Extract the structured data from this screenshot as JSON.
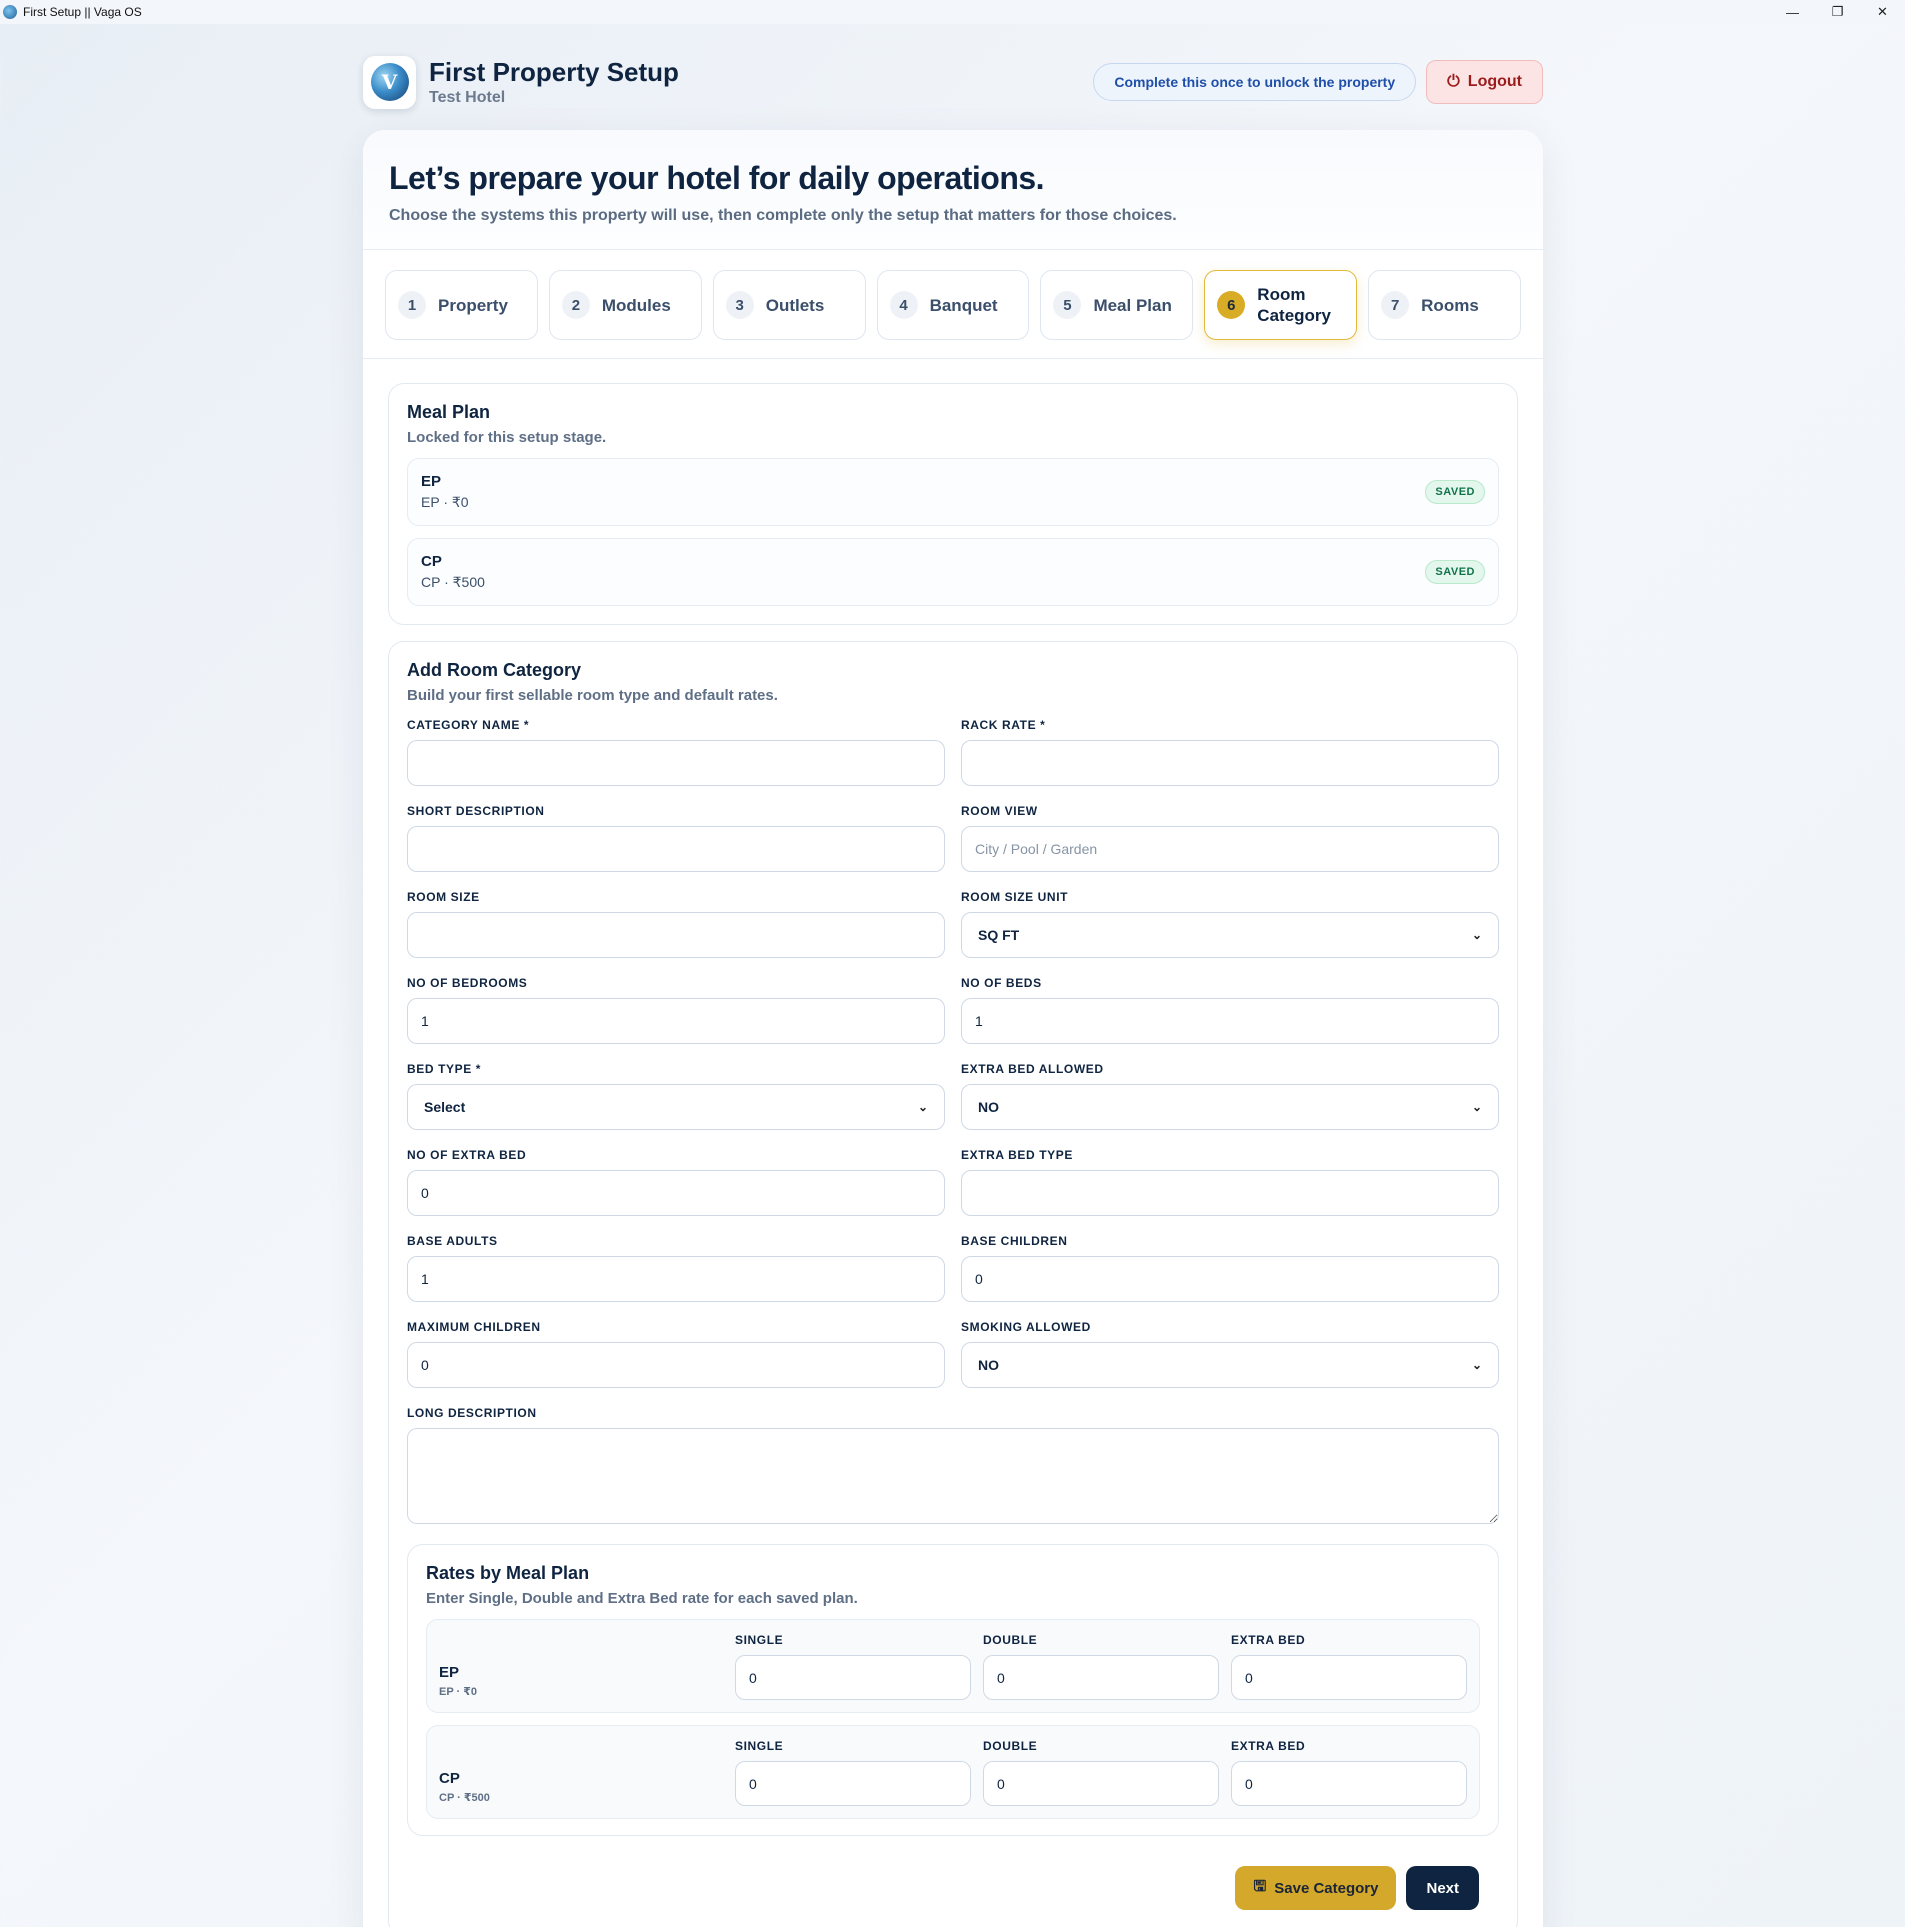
{
  "window": {
    "title": "First Setup || Vaga OS",
    "minimize": "—",
    "maximize": "❐",
    "close": "✕"
  },
  "header": {
    "title": "First Property Setup",
    "subtitle": "Test Hotel",
    "unlock_note": "Complete this once to unlock the property",
    "logout_label": "Logout",
    "logout_icon": "power-icon"
  },
  "hero": {
    "title": "Let’s prepare your hotel for daily operations.",
    "subtitle": "Choose the systems this property will use, then complete only the setup that matters for those choices."
  },
  "steps": [
    {
      "num": "1",
      "label": "Property"
    },
    {
      "num": "2",
      "label": "Modules"
    },
    {
      "num": "3",
      "label": "Outlets"
    },
    {
      "num": "4",
      "label": "Banquet"
    },
    {
      "num": "5",
      "label": "Meal Plan"
    },
    {
      "num": "6",
      "label": "Room Category"
    },
    {
      "num": "7",
      "label": "Rooms"
    }
  ],
  "meal_plan_panel": {
    "title": "Meal Plan",
    "subtitle": "Locked for this setup stage.",
    "plans": [
      {
        "name": "EP",
        "detail": "EP · ₹0",
        "status": "SAVED"
      },
      {
        "name": "CP",
        "detail": "CP · ₹500",
        "status": "SAVED"
      }
    ]
  },
  "room_category_form": {
    "title": "Add Room Category",
    "subtitle": "Build your first sellable room type and default rates.",
    "fields": {
      "category_name": {
        "label": "CATEGORY NAME *",
        "value": ""
      },
      "rack_rate": {
        "label": "RACK RATE *",
        "value": ""
      },
      "short_description": {
        "label": "SHORT DESCRIPTION",
        "value": ""
      },
      "room_view": {
        "label": "ROOM VIEW",
        "value": "",
        "placeholder": "City / Pool / Garden"
      },
      "room_size": {
        "label": "ROOM SIZE",
        "value": ""
      },
      "room_size_unit": {
        "label": "ROOM SIZE UNIT",
        "value": "SQ FT"
      },
      "no_of_bedrooms": {
        "label": "NO OF BEDROOMS",
        "value": "1"
      },
      "no_of_beds": {
        "label": "NO OF BEDS",
        "value": "1"
      },
      "bed_type": {
        "label": "BED TYPE *",
        "value": "Select"
      },
      "extra_bed_allowed": {
        "label": "EXTRA BED ALLOWED",
        "value": "NO"
      },
      "no_of_extra_bed": {
        "label": "NO OF EXTRA BED",
        "value": "0"
      },
      "extra_bed_type": {
        "label": "EXTRA BED TYPE",
        "value": ""
      },
      "base_adults": {
        "label": "BASE ADULTS",
        "value": "1"
      },
      "base_children": {
        "label": "BASE CHILDREN",
        "value": "0"
      },
      "maximum_children": {
        "label": "MAXIMUM CHILDREN",
        "value": "0"
      },
      "smoking_allowed": {
        "label": "SMOKING ALLOWED",
        "value": "NO"
      },
      "long_description": {
        "label": "LONG DESCRIPTION",
        "value": ""
      }
    }
  },
  "rates_panel": {
    "title": "Rates by Meal Plan",
    "subtitle": "Enter Single, Double and Extra Bed rate for each saved plan.",
    "columns": [
      "SINGLE",
      "DOUBLE",
      "EXTRA BED"
    ],
    "rows": [
      {
        "name": "EP",
        "detail": "EP · ₹0",
        "single": "0",
        "double": "0",
        "extra_bed": "0"
      },
      {
        "name": "CP",
        "detail": "CP · ₹500",
        "single": "0",
        "double": "0",
        "extra_bed": "0"
      }
    ]
  },
  "actions": {
    "save_label": "Save Category",
    "save_icon": "save-icon",
    "next_label": "Next"
  },
  "colors": {
    "primary": "#0f2440",
    "accent": "#d4a82a",
    "danger": "#9b1c1c",
    "success": "#12734a"
  }
}
